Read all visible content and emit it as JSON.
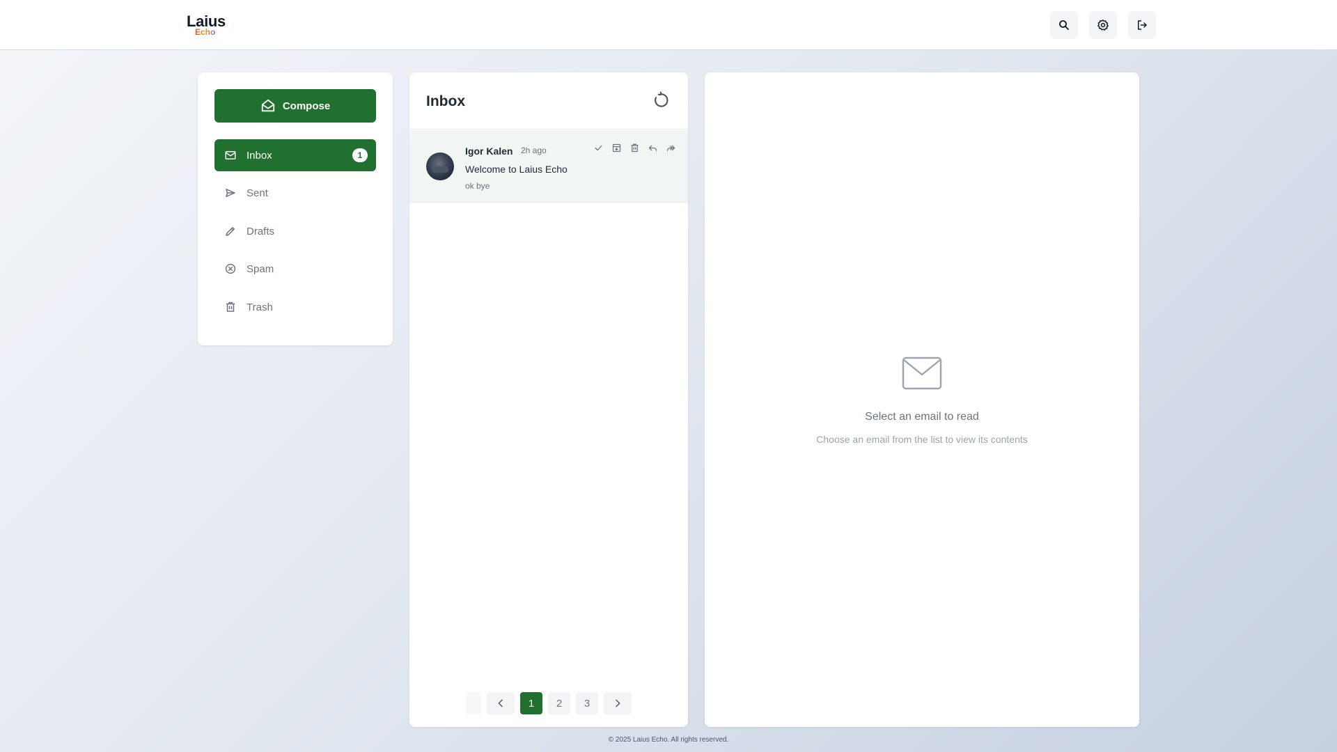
{
  "app": {
    "logo_main": "Laius",
    "logo_sub": "Echo"
  },
  "header": {
    "search_icon": "search-icon",
    "settings_icon": "gear-icon",
    "logout_icon": "logout-icon"
  },
  "sidebar": {
    "compose_label": "Compose",
    "items": [
      {
        "label": "Inbox",
        "icon": "mail-icon",
        "badge": "1",
        "active": true
      },
      {
        "label": "Sent",
        "icon": "send-icon"
      },
      {
        "label": "Drafts",
        "icon": "pencil-icon"
      },
      {
        "label": "Spam",
        "icon": "x-circle-icon"
      },
      {
        "label": "Trash",
        "icon": "trash-icon"
      }
    ]
  },
  "inbox": {
    "title": "Inbox",
    "emails": [
      {
        "sender": "Igor Kalen",
        "time": "2h ago",
        "subject": "Welcome to Laius Echo",
        "preview": "ok bye"
      }
    ],
    "pagination": {
      "pages": [
        "1",
        "2",
        "3"
      ],
      "current": "1"
    }
  },
  "reader": {
    "empty_title": "Select an email to read",
    "empty_subtitle": "Choose an email from the list to view its contents"
  },
  "footer": {
    "copyright": "© 2025 Laius Echo. All rights reserved."
  },
  "colors": {
    "accent": "#22702f",
    "background_start": "#f3f5f9",
    "background_end": "#c6d0e1"
  }
}
